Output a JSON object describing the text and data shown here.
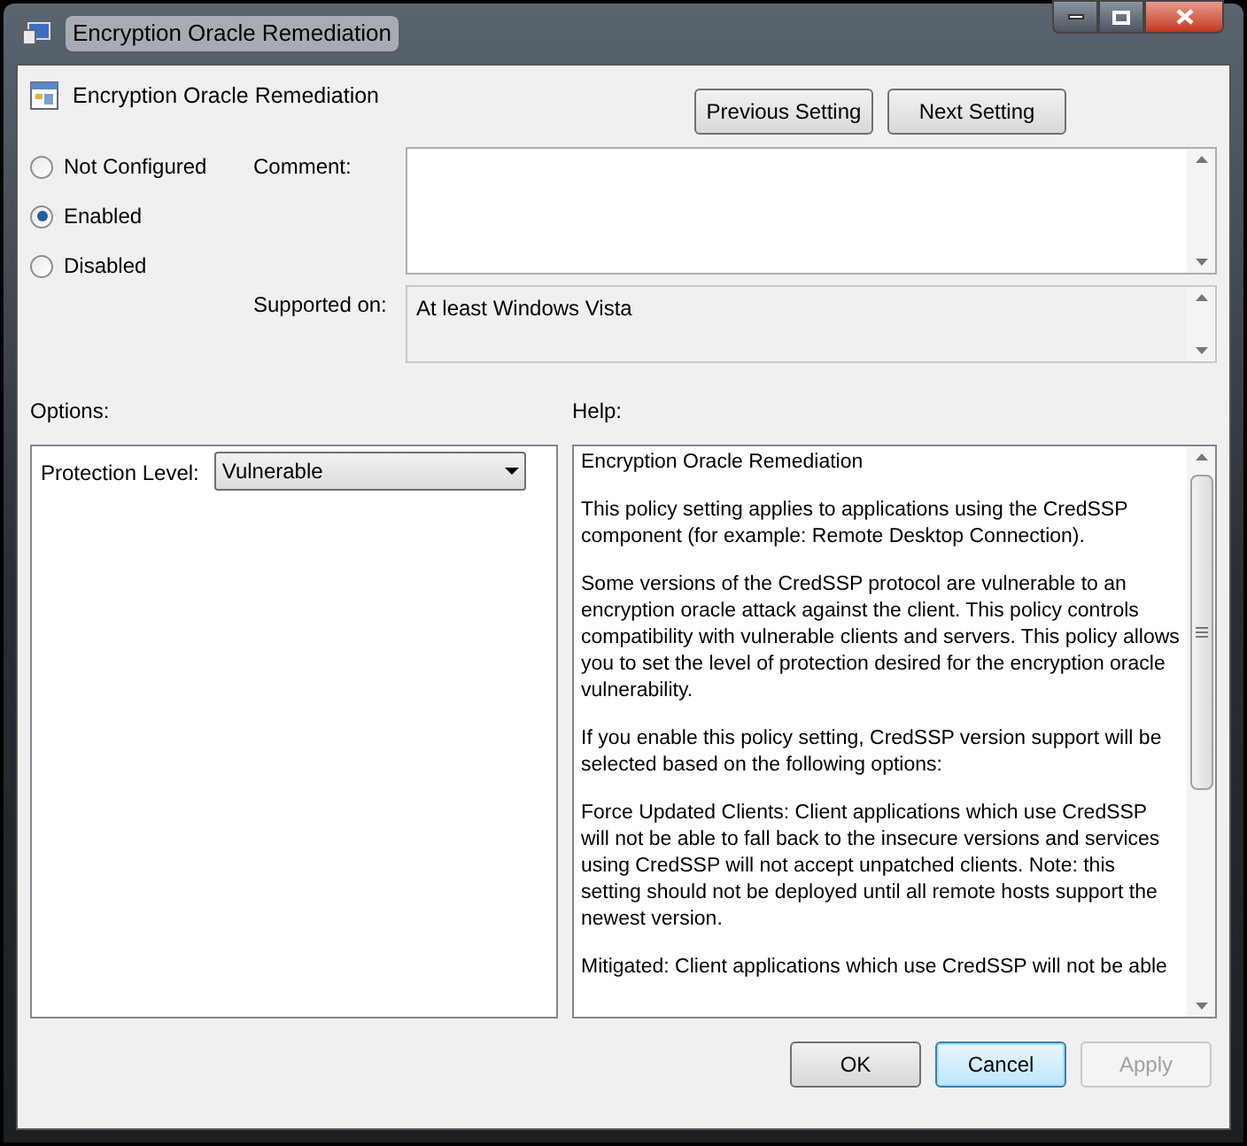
{
  "window": {
    "title": "Encryption Oracle Remediation"
  },
  "header": {
    "title": "Encryption Oracle Remediation"
  },
  "nav_buttons": [
    "Previous Setting",
    "Next Setting"
  ],
  "state_options": [
    {
      "label": "Not Configured",
      "selected": false
    },
    {
      "label": "Enabled",
      "selected": true
    },
    {
      "label": "Disabled",
      "selected": false
    }
  ],
  "comment": {
    "label": "Comment:"
  },
  "supported_on": {
    "label": "Supported on:",
    "value": "At least Windows Vista"
  },
  "options": {
    "label": "Options:",
    "protection_level": {
      "label": "Protection Level:",
      "value": "Vulnerable"
    }
  },
  "help": {
    "label": "Help:",
    "paragraphs": [
      "Encryption Oracle Remediation",
      "This policy setting applies to applications using the CredSSP component (for example: Remote Desktop Connection).",
      "Some versions of the CredSSP protocol are vulnerable to an encryption oracle attack against the client.  This policy controls compatibility with vulnerable clients and servers.  This policy allows you to set the level of protection desired for the encryption oracle vulnerability.",
      "If you enable this policy setting, CredSSP version support will be selected based on the following options:",
      "Force Updated Clients: Client applications which use CredSSP will not be able to fall back to the insecure versions and services using CredSSP will not accept unpatched clients. Note: this setting should not be deployed until all remote hosts support the newest version.",
      "Mitigated: Client applications which use CredSSP will not be able"
    ]
  },
  "footer_buttons": [
    {
      "label": "OK",
      "disabled": false,
      "default": false
    },
    {
      "label": "Cancel",
      "disabled": false,
      "default": true
    },
    {
      "label": "Apply",
      "disabled": true,
      "default": false
    }
  ]
}
